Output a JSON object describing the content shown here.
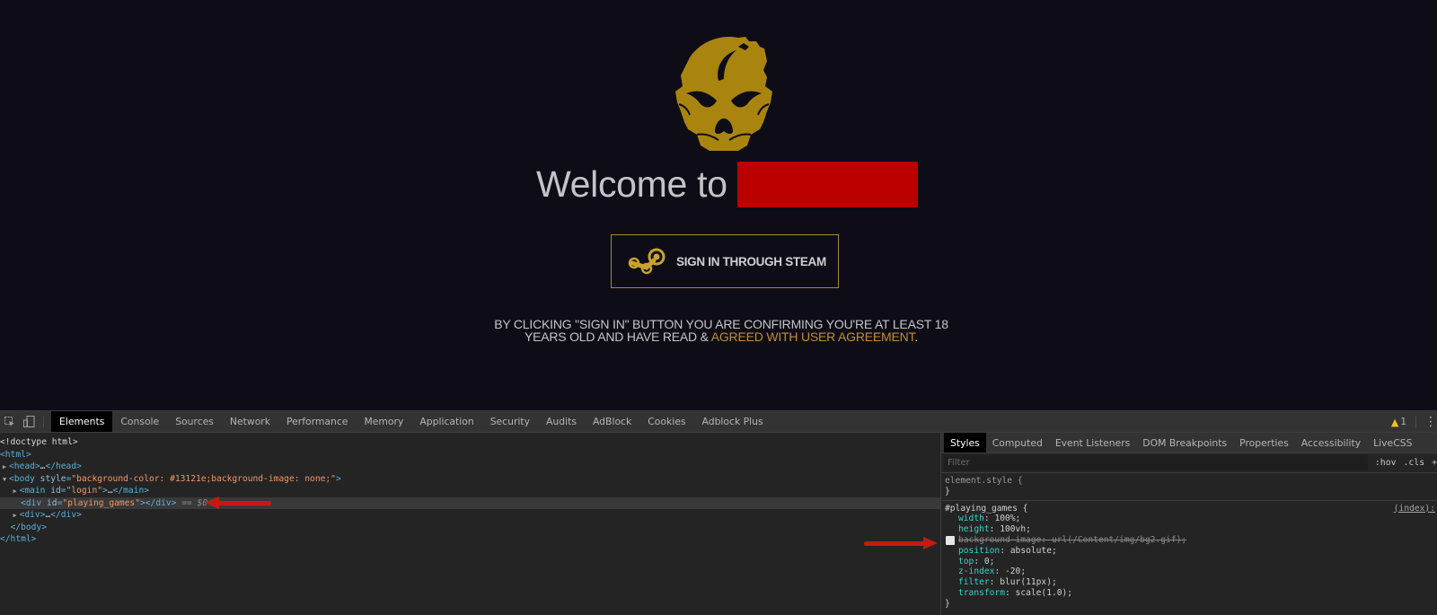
{
  "page": {
    "welcome_text": "Welcome to",
    "site_name_redacted": true,
    "sign_in_button": "SIGN IN THROUGH STEAM",
    "disclaimer_text": "BY CLICKING \"SIGN IN\" BUTTON YOU ARE CONFIRMING YOU'RE AT LEAST 18 YEARS OLD AND HAVE READ & ",
    "agreement_link": "AGREED WITH USER AGREEMENT",
    "disclaimer_end": ".",
    "colors": {
      "background": "#0e0d17",
      "logo_gold": "#a9850f",
      "redaction": "#bb0000",
      "button_border": "#a58a38",
      "link_gold": "#c18f2c"
    }
  },
  "devtools": {
    "toolbar": {
      "inspect_icon": "inspect-element-icon",
      "device_icon": "device-toolbar-icon",
      "tabs": [
        "Elements",
        "Console",
        "Sources",
        "Network",
        "Performance",
        "Memory",
        "Application",
        "Security",
        "Audits",
        "AdBlock",
        "Cookies",
        "Adblock Plus"
      ],
      "active_tab": "Elements",
      "warning_count": "1",
      "menu_icon": "kebab-menu-icon"
    },
    "elements": {
      "doctype": "<!doctype html>",
      "html_open": "<html>",
      "head_open": "<head>",
      "ellipsis": "…",
      "head_close": "</head>",
      "body_tag": "body",
      "body_attr_name": "style",
      "body_attr_value": "background-color: #13121e;background-image: none;",
      "main_tag": "main",
      "main_attr_name": "id",
      "main_attr_value": "login",
      "main_close": "</main>",
      "div_tag": "div",
      "div_attr_name": "id",
      "div_attr_value": "playing_games",
      "div_close": "</div>",
      "selected_marker": " == $0",
      "div2_open": "<div>",
      "div2_close": "</div>",
      "body_close": "</body>",
      "html_close": "</html>"
    },
    "styles": {
      "tabs": [
        "Styles",
        "Computed",
        "Event Listeners",
        "DOM Breakpoints",
        "Properties",
        "Accessibility",
        "LiveCSS"
      ],
      "active_tab": "Styles",
      "filter_placeholder": "Filter",
      "hov_button": ":hov",
      "cls_button": ".cls",
      "add_button": "+",
      "element_style_selector": "element.style {",
      "close_brace": "}",
      "rule_selector": "#playing_games {",
      "rule_source": "(index):",
      "properties": [
        {
          "name": "width",
          "value": "100%;",
          "disabled": false
        },
        {
          "name": "height",
          "value": "100vh;",
          "disabled": false
        },
        {
          "name": "background-image",
          "value": "url(/Content/img/bg2.gif);",
          "disabled": true
        },
        {
          "name": "position",
          "value": "absolute;",
          "disabled": false
        },
        {
          "name": "top",
          "value": "0;",
          "disabled": false
        },
        {
          "name": "z-index",
          "value": "-20;",
          "disabled": false
        },
        {
          "name": "filter",
          "value": "blur(11px);",
          "disabled": false
        },
        {
          "name": "transform",
          "value": "scale(1.0);",
          "disabled": false
        }
      ]
    }
  }
}
